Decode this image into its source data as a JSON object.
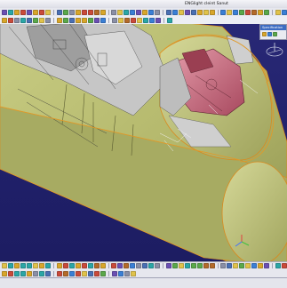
{
  "window": {
    "title": "ENGlight cleint Sanut"
  },
  "toolbars": {
    "top_row_1": [
      "select",
      "undo",
      "redo",
      "cut",
      "copy",
      "paste",
      "open",
      "save",
      "print",
      "search",
      "grid",
      "measure",
      "sketch",
      "pad",
      "pocket",
      "shaft",
      "groove",
      "hole",
      "rib",
      "slot",
      "fillet",
      "chamfer",
      "draft",
      "shell",
      "thicken",
      "mirror",
      "pattern",
      "scale",
      "split",
      "sew",
      "close",
      "boolean",
      "union",
      "remove",
      "intersect",
      "assemble",
      "part",
      "analyze",
      "render",
      "camera",
      "light",
      "material"
    ],
    "top_row_2": [
      "view-front",
      "view-back",
      "view-top",
      "view-iso",
      "zoom-in",
      "zoom-out",
      "fit-all",
      "pan",
      "rotate",
      "normal",
      "multiview",
      "shading",
      "wire",
      "hide",
      "swap",
      "layers",
      "filter",
      "snap",
      "axis",
      "plane",
      "point",
      "line",
      "curve",
      "surface",
      "solid"
    ],
    "bottom_row_1": [
      "point",
      "line",
      "axis",
      "polyline",
      "plane",
      "projection",
      "intersection",
      "circle",
      "spline",
      "helix",
      "extrude",
      "revolve",
      "sphere",
      "cylinder",
      "offset",
      "sweep",
      "fill",
      "blend",
      "loft",
      "join",
      "heal",
      "untrim",
      "disassemble",
      "split",
      "trim",
      "boundary",
      "extract",
      "fillet",
      "translate",
      "rotate",
      "symmetry",
      "scale",
      "affinity",
      "repetition",
      "law",
      "analysis",
      "measure",
      "constraint",
      "update",
      "parameter",
      "formula",
      "knowledge"
    ],
    "bottom_row_2": [
      "std-select",
      "std-ruler",
      "std-compass",
      "std-grid",
      "std-snap",
      "std-layer",
      "std-color",
      "std-hide",
      "std-show",
      "std-isolate",
      "std-section",
      "std-clash",
      "std-annot",
      "std-camera",
      "std-record",
      "std-play",
      "std-stop",
      "std-export",
      "std-import",
      "std-help"
    ]
  },
  "icon_colors": [
    "#d8a62a",
    "#3a7fd5",
    "#c94a3a",
    "#5aa84a",
    "#8a8fa6",
    "#e0c24a",
    "#6a4fb3",
    "#2aa6a6",
    "#b36a2a",
    "#4a6fb3"
  ],
  "spec_panel": {
    "title": "Specification"
  },
  "status": {
    "text": ""
  },
  "scene_colors": {
    "background": "#23236a",
    "fuselage": "#b9bd72",
    "fuselage_dark": "#8a8e4c",
    "edge_orange": "#d98a1f",
    "cockpit_red": "#c7637a",
    "structure_gray": "#b8b8b8"
  }
}
